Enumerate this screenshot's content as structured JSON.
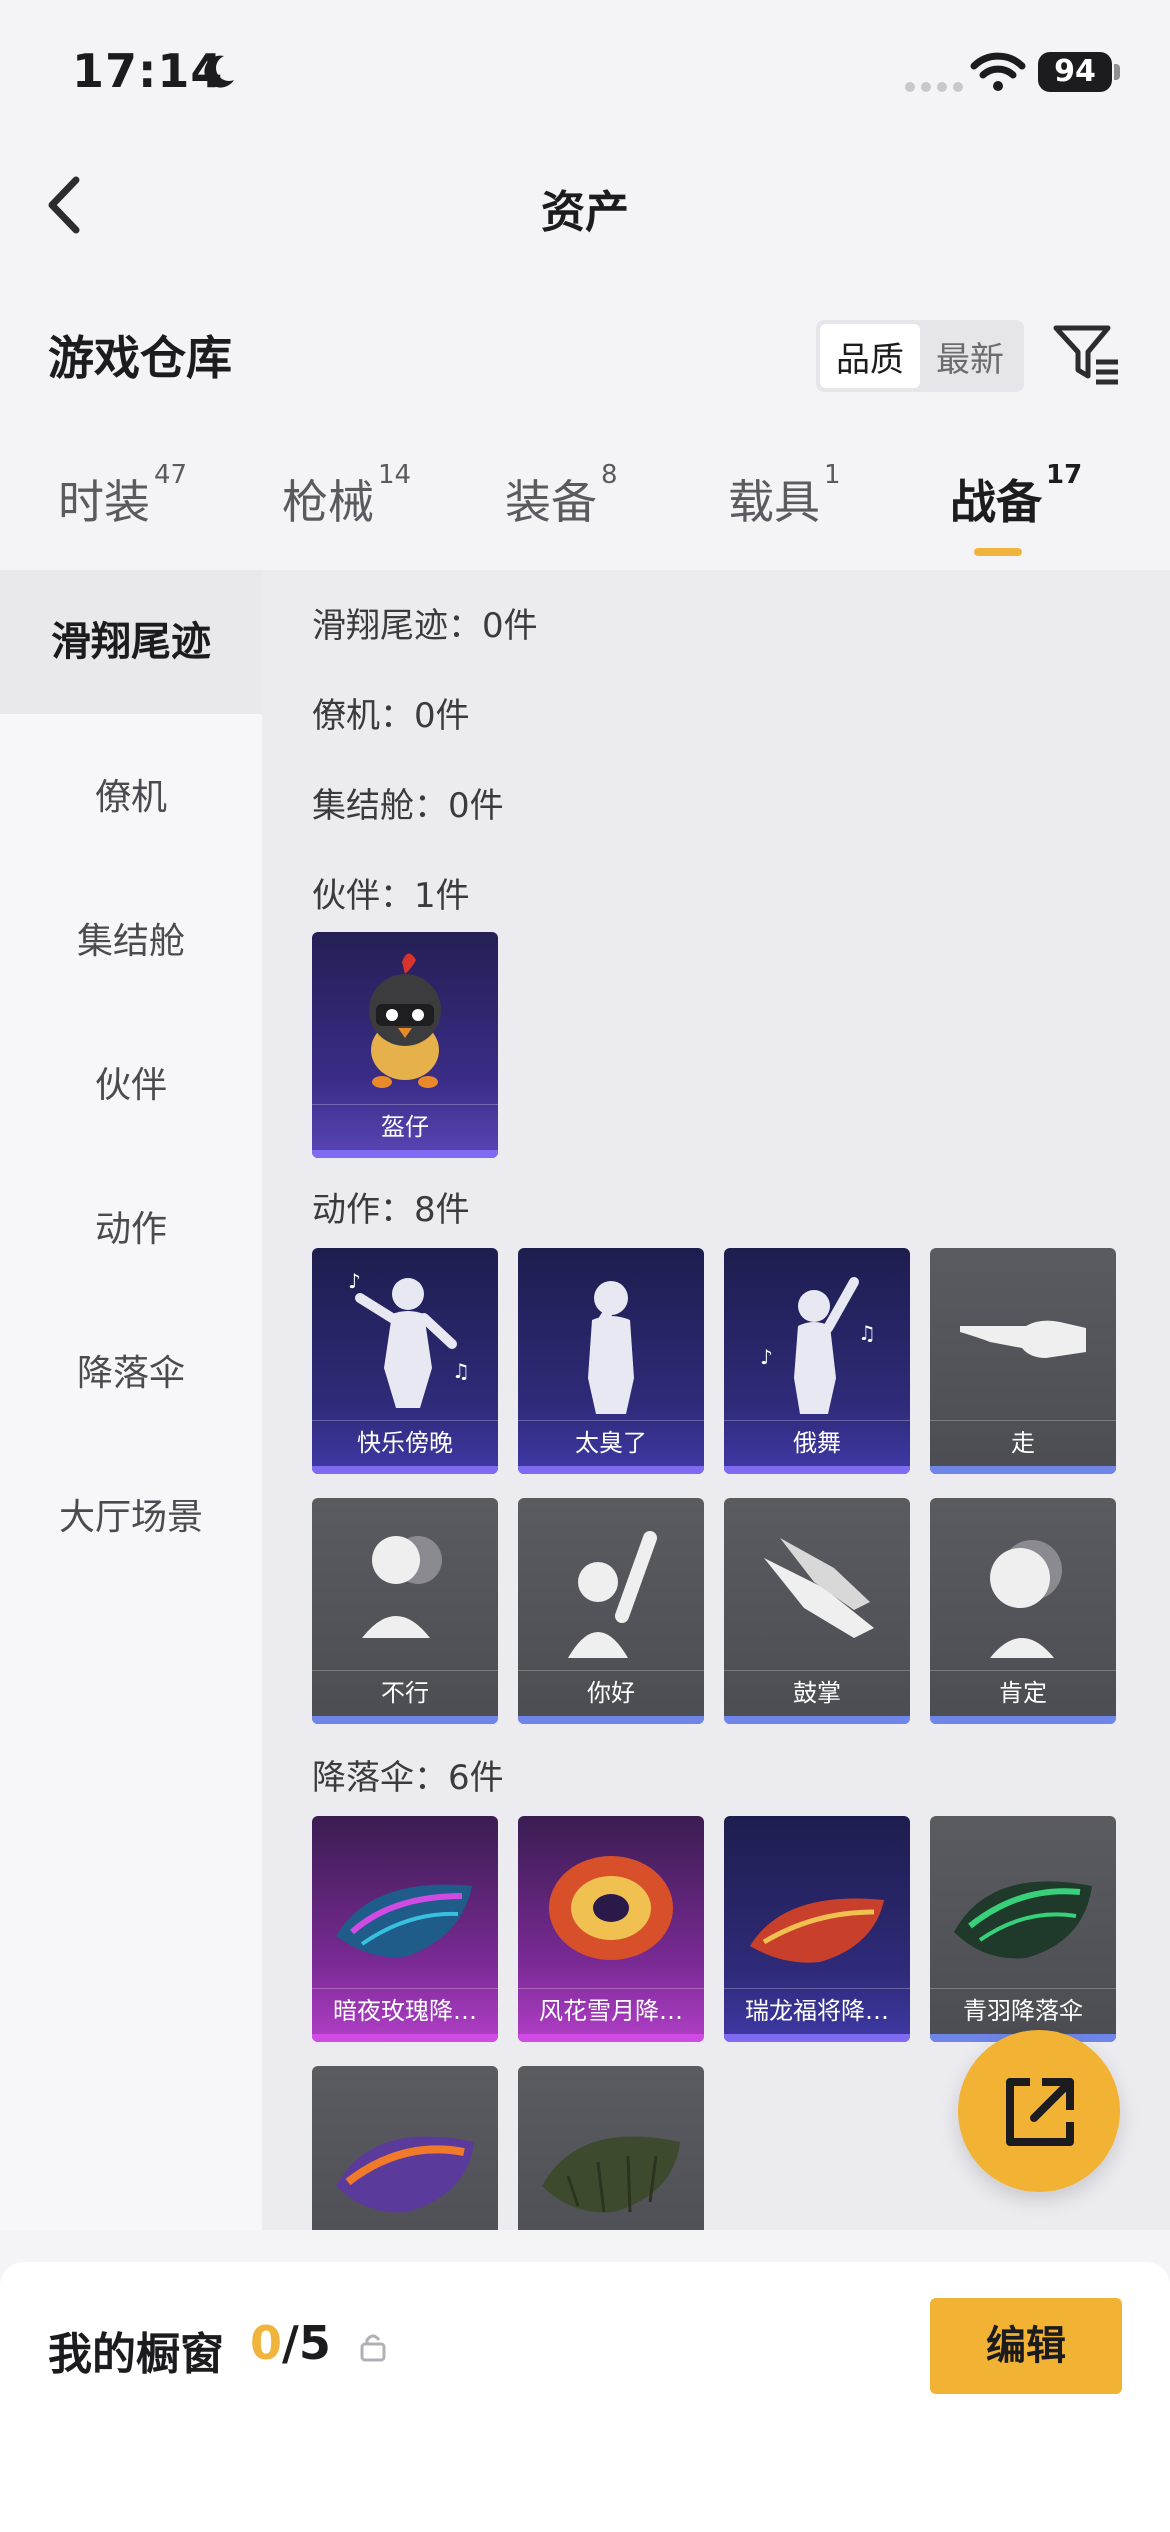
{
  "status_bar": {
    "time": "17:14",
    "battery": "94"
  },
  "header": {
    "title": "资产"
  },
  "warehouse": {
    "title": "游戏仓库",
    "sort_options": [
      "品质",
      "最新"
    ],
    "active_sort": "品质"
  },
  "tabs": [
    {
      "label": "时装",
      "count": "47"
    },
    {
      "label": "枪械",
      "count": "14"
    },
    {
      "label": "装备",
      "count": "8"
    },
    {
      "label": "载具",
      "count": "1"
    },
    {
      "label": "战备",
      "count": "17"
    }
  ],
  "active_tab": "战备",
  "sidebar": {
    "items": [
      "滑翔尾迹",
      "僚机",
      "集结舱",
      "伙伴",
      "动作",
      "降落伞",
      "大厅场景"
    ],
    "active": "滑翔尾迹"
  },
  "categories": {
    "trail": "滑翔尾迹：0件",
    "wingman": "僚机：0件",
    "pod": "集结舱：0件",
    "partner": "伙伴：1件",
    "emote": "动作：8件",
    "parachute": "降落伞：6件"
  },
  "partner_items": [
    "盔仔"
  ],
  "emote_items": [
    "快乐傍晚",
    "太臭了",
    "俄舞",
    "走",
    "不行",
    "你好",
    "鼓掌",
    "肯定"
  ],
  "parachute_items": [
    "暗夜玫瑰降…",
    "风花雪月降…",
    "瑞龙福将降…",
    "青羽降落伞",
    "",
    ""
  ],
  "bottom_bar": {
    "label": "我的橱窗",
    "current": "0",
    "separator": "/",
    "max": "5",
    "edit_label": "编辑"
  },
  "colors": {
    "accent": "#f2b233",
    "tab_underline": "#f0b43c"
  }
}
